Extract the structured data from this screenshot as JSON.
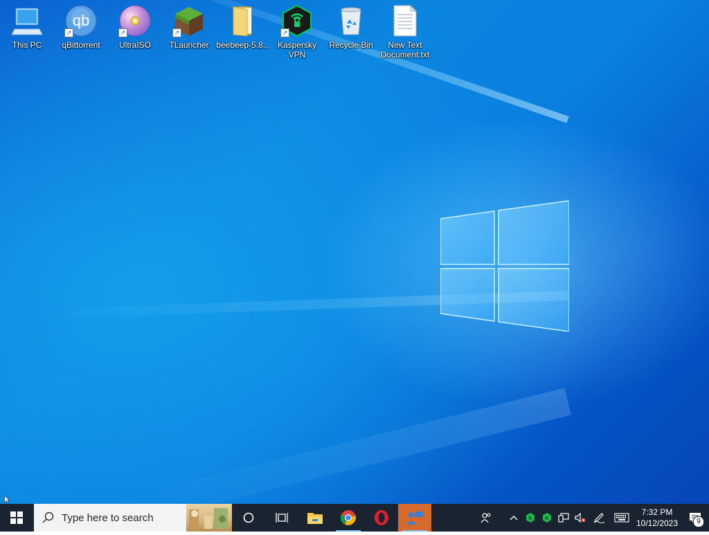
{
  "desktop": {
    "icons": [
      {
        "label": "This PC",
        "icon": "this-pc-icon"
      },
      {
        "label": "qBittorrent",
        "icon": "qbittorrent-icon",
        "glyph": "qb"
      },
      {
        "label": "UltraISO",
        "icon": "ultraiso-icon"
      },
      {
        "label": "TLauncher",
        "icon": "tlauncher-icon"
      },
      {
        "label": "beebeep-5.8...",
        "icon": "folder-icon"
      },
      {
        "label": "Kaspersky VPN",
        "icon": "kaspersky-vpn-icon"
      },
      {
        "label": "Recycle Bin",
        "icon": "recycle-bin-icon"
      },
      {
        "label": "New Text Document.txt",
        "icon": "text-document-icon"
      }
    ]
  },
  "taskbar": {
    "search_placeholder": "Type here to search",
    "pinned": [
      "cortana-icon",
      "task-view-icon",
      "file-explorer-icon",
      "chrome-icon",
      "opera-icon",
      "beebeep-icon"
    ],
    "clock": {
      "time": "7:32 PM",
      "date": "10/12/2023"
    },
    "notifications_count": "9"
  },
  "colors": {
    "taskbar_bg": "#1a2430",
    "desktop_blue": "#0a7fe0"
  }
}
